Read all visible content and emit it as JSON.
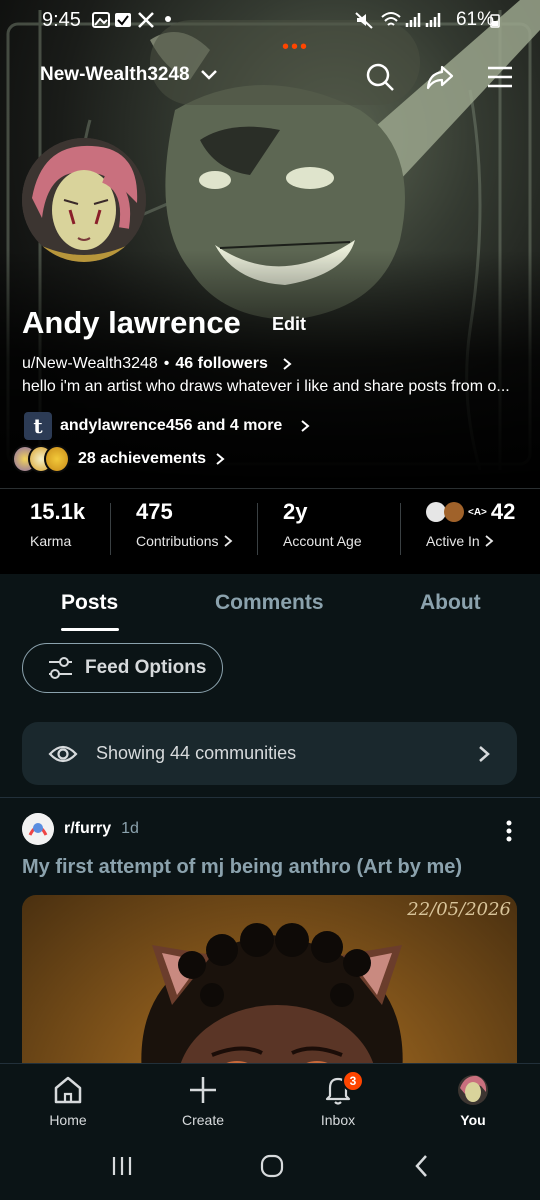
{
  "status_bar": {
    "time": "9:45",
    "battery": "61%"
  },
  "header": {
    "username": "New-Wealth3248",
    "icons": [
      "chevron-down-icon",
      "search-icon",
      "share-icon",
      "menu-icon"
    ]
  },
  "profile": {
    "display_name": "Andy lawrence",
    "edit_label": "Edit",
    "handle": "u/New-Wealth3248",
    "separator": "•",
    "followers": "46 followers",
    "bio": "hello i'm an artist who draws whatever i like and share posts from o...",
    "social_letter": "t",
    "social_text": "andylawrence456 and 4 more",
    "achievements": "28 achievements"
  },
  "stats": {
    "karma_value": "15.1k",
    "karma_label": "Karma",
    "contrib_value": "475",
    "contrib_label": "Contributions",
    "age_value": "2y",
    "age_label": "Account Age",
    "active_value": "42",
    "active_label": "Active In",
    "active_badge_text": "<A>"
  },
  "tabs": {
    "posts": "Posts",
    "comments": "Comments",
    "about": "About"
  },
  "feed_options": "Feed Options",
  "communities_text": "Showing 44 communities",
  "post": {
    "subreddit": "r/furry",
    "age": "1d",
    "title": "My first attempt of mj being anthro (Art by me)",
    "image_date": "22/05/2026"
  },
  "bottom_nav": {
    "home": "Home",
    "create": "Create",
    "inbox": "Inbox",
    "you": "You",
    "inbox_badge": "3"
  },
  "colors": {
    "accent": "#ff4500",
    "background": "#0b1416",
    "muted": "#8ba2ad",
    "card": "#1a282d"
  }
}
